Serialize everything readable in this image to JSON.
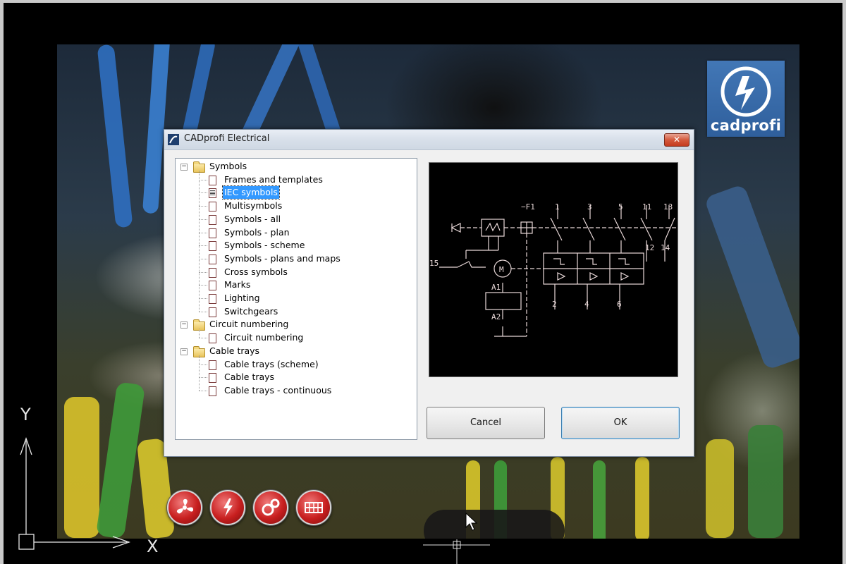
{
  "dialog": {
    "title": "CADprofi Electrical",
    "close_label": "✕",
    "cancel_label": "Cancel",
    "ok_label": "OK"
  },
  "tree": {
    "groups": [
      {
        "label": "Symbols",
        "expander": "−",
        "items": [
          "Frames and templates",
          "IEC symbols",
          "Multisymbols",
          "Symbols - all",
          "Symbols - plan",
          "Symbols - scheme",
          "Symbols - plans and maps",
          "Cross symbols",
          "Marks",
          "Lighting",
          "Switchgears"
        ]
      },
      {
        "label": "Circuit numbering",
        "expander": "−",
        "items": [
          "Circuit numbering"
        ]
      },
      {
        "label": "Cable trays",
        "expander": "−",
        "items": [
          "Cable trays (scheme)",
          "Cable trays",
          "Cable trays - continuous"
        ]
      }
    ],
    "selected": "IEC symbols"
  },
  "preview": {
    "labels": {
      "breaker": "−F1",
      "pin1": "1",
      "pin3": "3",
      "pin5": "5",
      "pin11": "11",
      "pin13": "13",
      "pin2": "2",
      "pin4": "4",
      "pin6": "6",
      "pin12": "12",
      "pin14": "14",
      "pin15": "15",
      "motor": "M",
      "a1": "A1",
      "a2": "A2"
    },
    "line_color": "#e8d8d8"
  },
  "logo": {
    "text": "cadprofi",
    "color": "#3a6fb0"
  },
  "ucs": {
    "x_label": "X",
    "y_label": "Y"
  },
  "toolbar_icons": [
    "fan-icon",
    "lightning-icon",
    "gears-icon",
    "cable-tray-icon"
  ]
}
